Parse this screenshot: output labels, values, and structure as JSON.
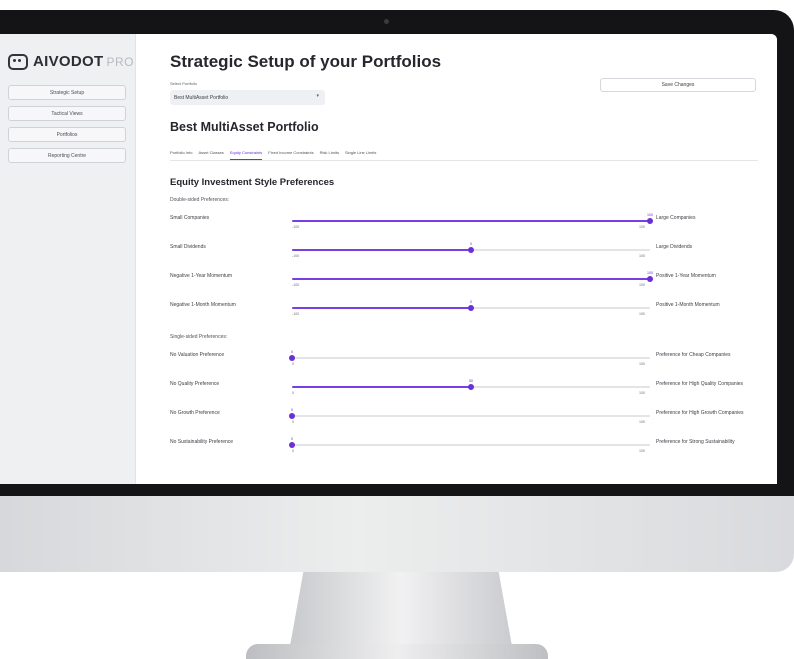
{
  "app": {
    "logo_text": "AIVODOT",
    "logo_suffix": "PRO"
  },
  "sidebar": {
    "items": [
      {
        "label": "Strategic Setup"
      },
      {
        "label": "Tactical Views"
      },
      {
        "label": "Portfolios"
      },
      {
        "label": "Reporting Centre"
      }
    ]
  },
  "main": {
    "page_title": "Strategic Setup of your Portfolios",
    "select_label": "Select Portfolio",
    "selected_portfolio": "Best MultiAsset Portfolio",
    "save_label": "Save Changes",
    "portfolio_title": "Best MultiAsset Portfolio",
    "tabs": [
      {
        "label": "Portfolio Info",
        "active": false
      },
      {
        "label": "Asset Classes",
        "active": false
      },
      {
        "label": "Equity Constraints",
        "active": true
      },
      {
        "label": "Fixed Income Constraints",
        "active": false
      },
      {
        "label": "Risk Limits",
        "active": false
      },
      {
        "label": "Single Line Limits",
        "active": false
      }
    ],
    "section_title": "Equity Investment Style Preferences",
    "double_label": "Double-sided Preferences:",
    "single_label": "Single-sided Preferences:"
  },
  "double_sided": [
    {
      "left": "Small Companies",
      "right": "Large Companies",
      "min": "-100",
      "max": "100",
      "value": 100
    },
    {
      "left": "Small Dividends",
      "right": "Large Dividends",
      "min": "-100",
      "max": "100",
      "value": 0
    },
    {
      "left": "Negative 1-Year Momentum",
      "right": "Positive 1-Year Momentum",
      "min": "-100",
      "max": "100",
      "value": 100
    },
    {
      "left": "Negative 1-Month Momentum",
      "right": "Positive 1-Month Momentum",
      "min": "-100",
      "max": "100",
      "value": 0
    }
  ],
  "single_sided": [
    {
      "left": "No Valuation Preference",
      "right": "Preference for Cheap Companies",
      "min": "0",
      "max": "100",
      "value": 0
    },
    {
      "left": "No Quality Preference",
      "right": "Preference for High Quality Companies",
      "min": "0",
      "max": "100",
      "value": 50
    },
    {
      "left": "No Growth Preference",
      "right": "Preference for High Growth Companies",
      "min": "0",
      "max": "100",
      "value": 0
    },
    {
      "left": "No Sustainability Preference",
      "right": "Preference for Strong Sustainability",
      "min": "0",
      "max": "100",
      "value": 0
    }
  ],
  "colors": {
    "accent": "#6b2fd6",
    "track": "#e2e4e8",
    "sidebar_bg": "#eff0f2",
    "bezel": "#141416"
  },
  "icons": {
    "logo": "chat-bubble-logo-icon",
    "select_chevron": "chevron-down-icon"
  }
}
